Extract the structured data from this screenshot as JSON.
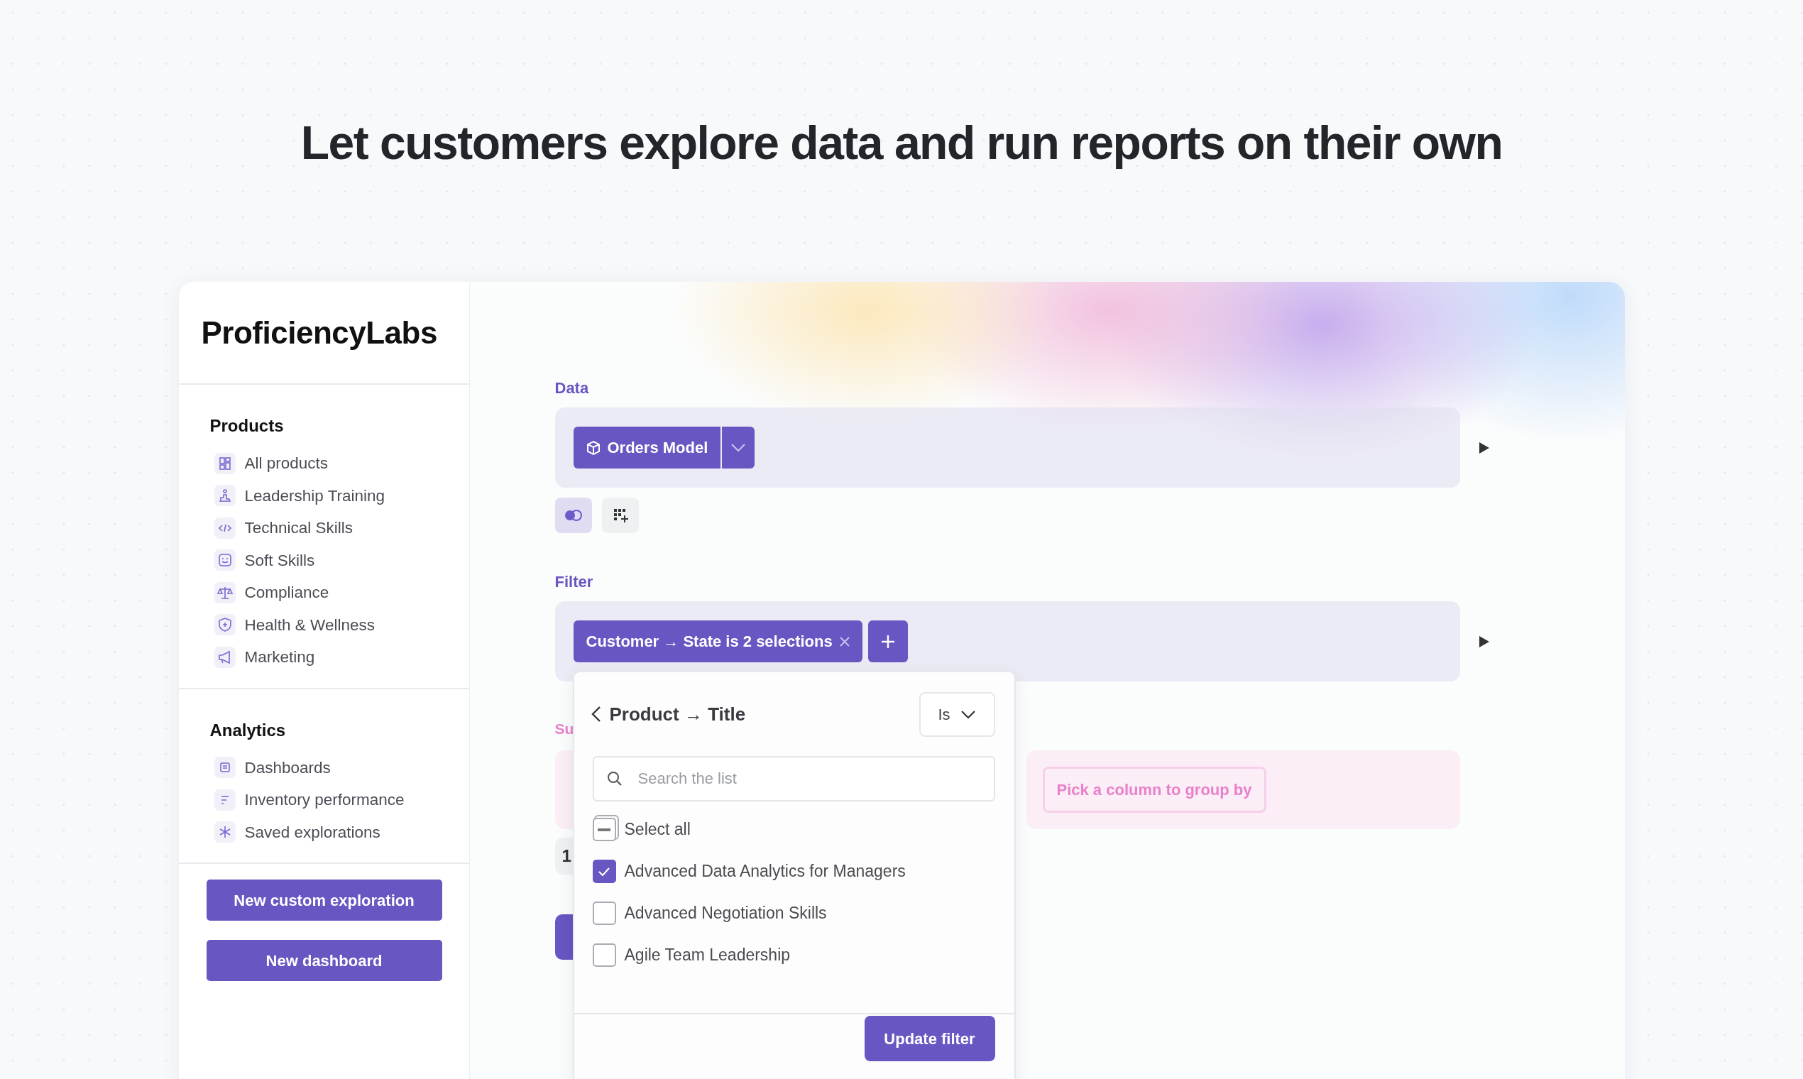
{
  "headline": "Let customers explore data and run reports on their own",
  "brand": "ProficiencyLabs",
  "sidebar": {
    "sections": [
      {
        "title": "Products",
        "items": [
          {
            "label": "All products"
          },
          {
            "label": "Leadership Training"
          },
          {
            "label": "Technical Skills"
          },
          {
            "label": "Soft Skills"
          },
          {
            "label": "Compliance"
          },
          {
            "label": "Health & Wellness"
          },
          {
            "label": "Marketing"
          }
        ]
      },
      {
        "title": "Analytics",
        "items": [
          {
            "label": "Dashboards"
          },
          {
            "label": "Inventory performance"
          },
          {
            "label": "Saved explorations"
          }
        ]
      }
    ],
    "buttons": [
      "New custom exploration",
      "New dashboard"
    ]
  },
  "data_section": {
    "label": "Data",
    "source_button": "Orders Model",
    "tools": [
      {
        "selected": true
      },
      {
        "selected": false
      }
    ]
  },
  "filter_section": {
    "label": "Filter",
    "chip": "Customer → State is 2 selections"
  },
  "summarize_section": {
    "label": "Su",
    "row_value": "1",
    "group_by_button": "Pick a column to group by"
  },
  "popup": {
    "title": "Product → Title",
    "operator": "Is",
    "search": {
      "placeholder": "Search the list"
    },
    "select_all": {
      "label": "Select all",
      "indeterminate": true
    },
    "options": [
      {
        "label": "Advanced Data Analytics for Managers",
        "checked": true
      },
      {
        "label": "Advanced Negotiation Skills",
        "checked": false
      },
      {
        "label": "Agile Team Leadership",
        "checked": false
      }
    ],
    "button": "Update filter"
  }
}
